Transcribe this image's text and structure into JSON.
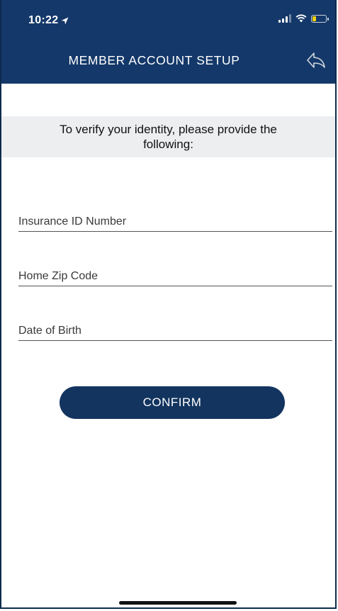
{
  "status_bar": {
    "time": "10:22",
    "icons": [
      "location-arrow-icon",
      "signal-icon",
      "wifi-icon",
      "battery-icon"
    ],
    "battery_color": "#f3d10e",
    "battery_level": 0.25
  },
  "header": {
    "title": "MEMBER ACCOUNT SETUP",
    "back_icon": "back-arrow-icon",
    "background": "#143869"
  },
  "banner": {
    "text": "To verify your identity, please provide the following:"
  },
  "form": {
    "insurance_id": {
      "placeholder": "Insurance ID Number",
      "value": ""
    },
    "zip_code": {
      "placeholder": "Home Zip Code",
      "value": ""
    },
    "date_of_birth": {
      "placeholder": "Date of Birth",
      "value": ""
    }
  },
  "actions": {
    "confirm_label": "CONFIRM",
    "confirm_color": "#12345f"
  }
}
